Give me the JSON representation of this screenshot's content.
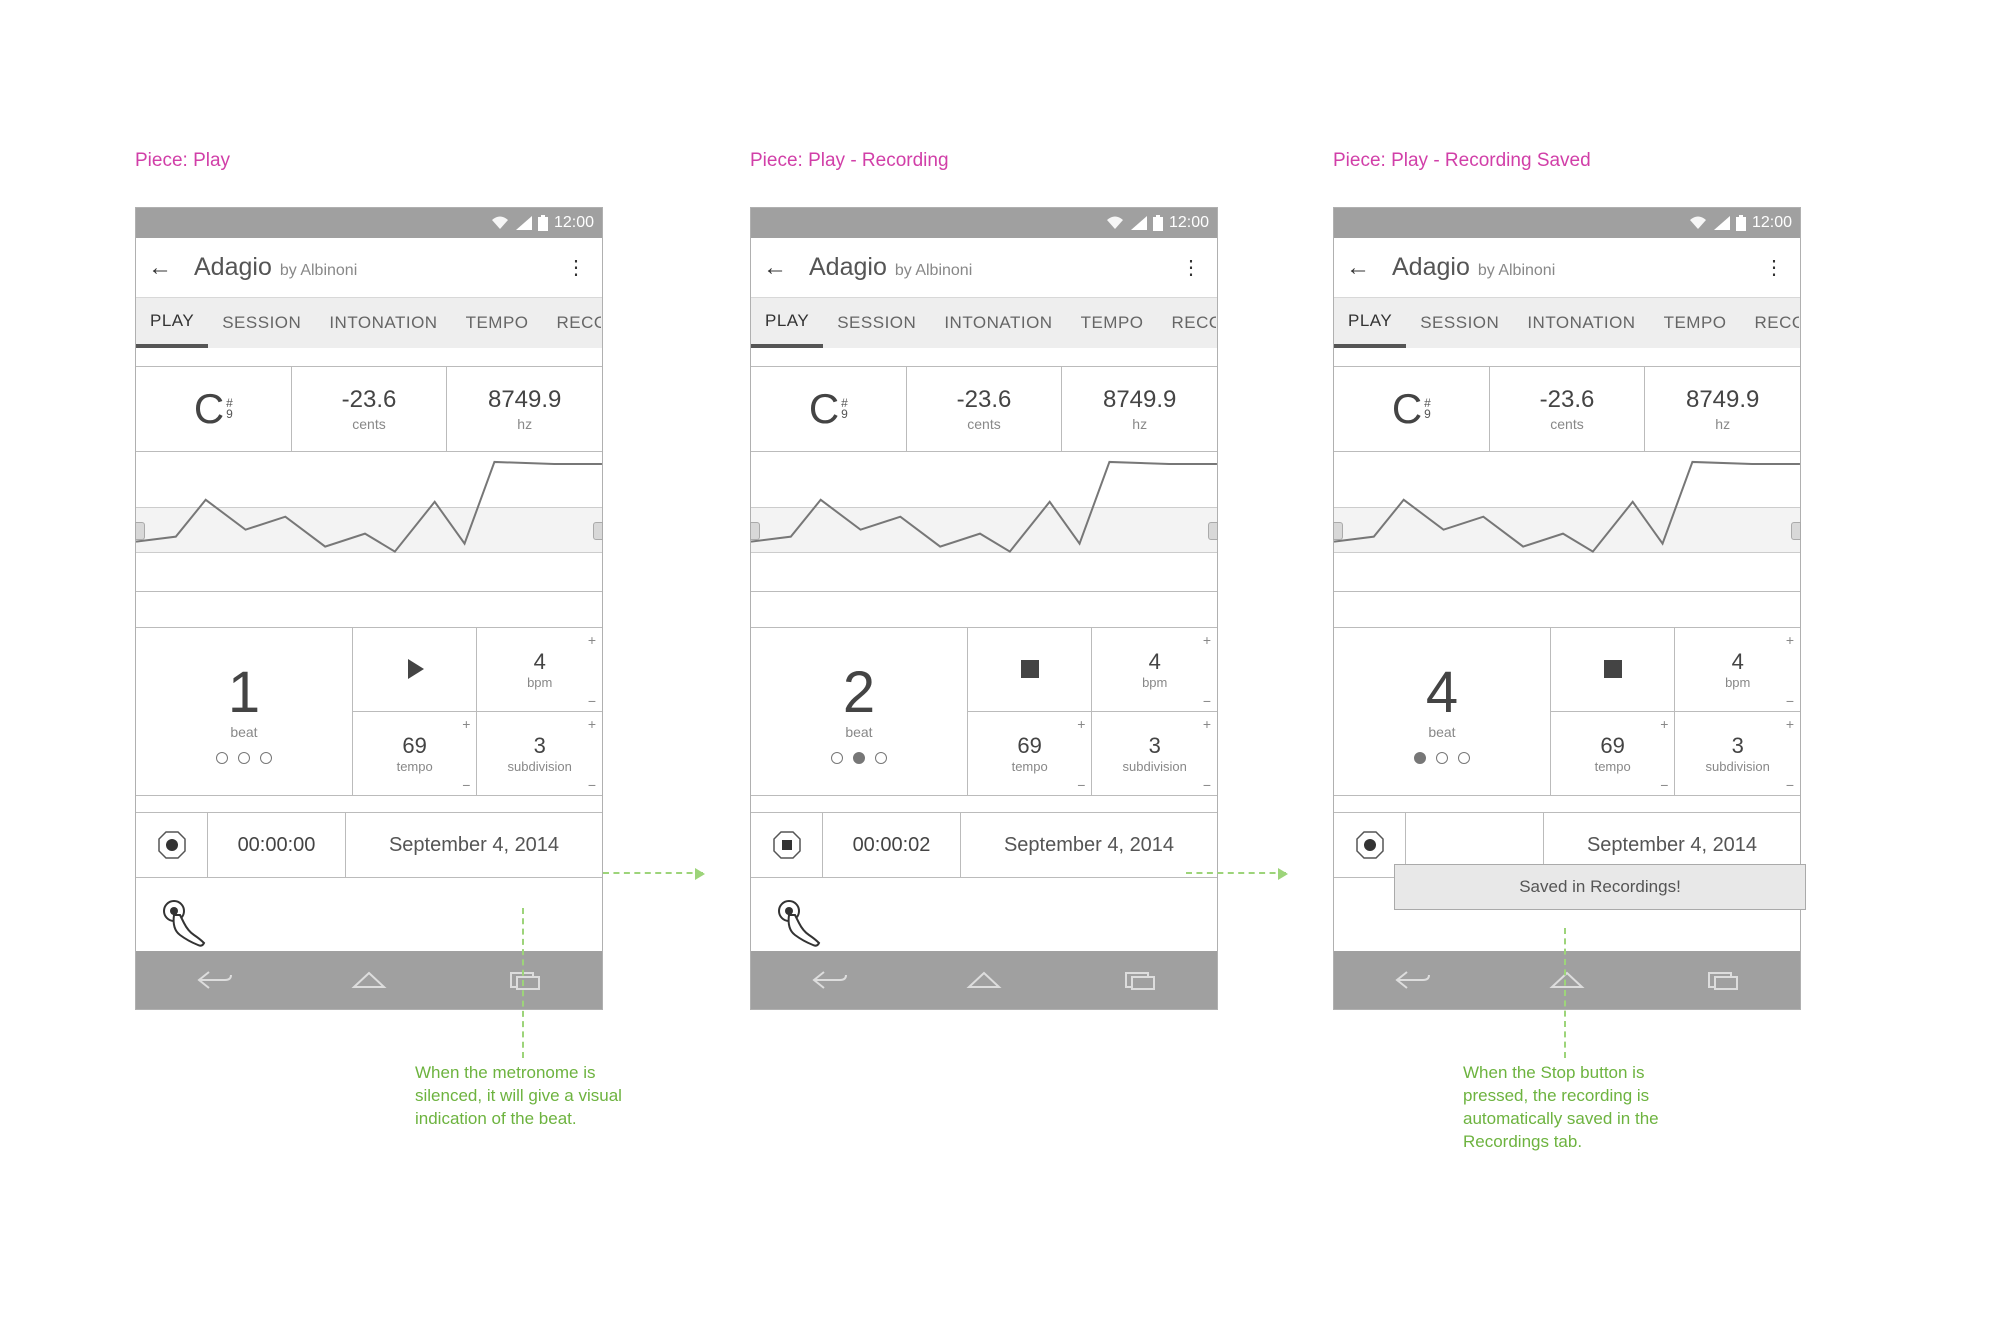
{
  "status": {
    "time": "12:00"
  },
  "header": {
    "title": "Adagio",
    "subtitle": "by Albinoni"
  },
  "tabs": [
    "PLAY",
    "SESSION",
    "INTONATION",
    "TEMPO",
    "RECORDINGS"
  ],
  "tuner": {
    "note_letter": "C",
    "note_accidental": "#",
    "note_octave": "9",
    "cents_value": "-23.6",
    "cents_label": "cents",
    "hz_value": "8749.9",
    "hz_label": "hz"
  },
  "metronome": {
    "beat_label": "beat",
    "bpm_value": "4",
    "bpm_label": "bpm",
    "tempo_value": "69",
    "tempo_label": "tempo",
    "subdivision_value": "3",
    "subdivision_label": "subdivision"
  },
  "recording": {
    "name": "September 4, 2014"
  },
  "screens": [
    {
      "caption": "Piece: Play",
      "beat": "1",
      "dots": [
        false,
        false,
        false
      ],
      "transport": "play",
      "rec_time": "00:00:00",
      "rec_icon": "circle",
      "show_hand": true,
      "annotation": "When the metronome is silenced, it will give a visual indication of the beat."
    },
    {
      "caption": "Piece: Play - Recording",
      "beat": "2",
      "dots": [
        false,
        true,
        false
      ],
      "transport": "stop",
      "rec_time": "00:00:02",
      "rec_icon": "square",
      "show_hand": true,
      "annotation": ""
    },
    {
      "caption": "Piece: Play - Recording Saved",
      "beat": "4",
      "dots": [
        true,
        false,
        false
      ],
      "transport": "stop",
      "rec_time": "",
      "rec_icon": "circle",
      "show_hand": false,
      "toast": "Saved in Recordings!",
      "annotation": "When the Stop button is pressed, the recording is automatically saved in the Recordings tab."
    }
  ]
}
